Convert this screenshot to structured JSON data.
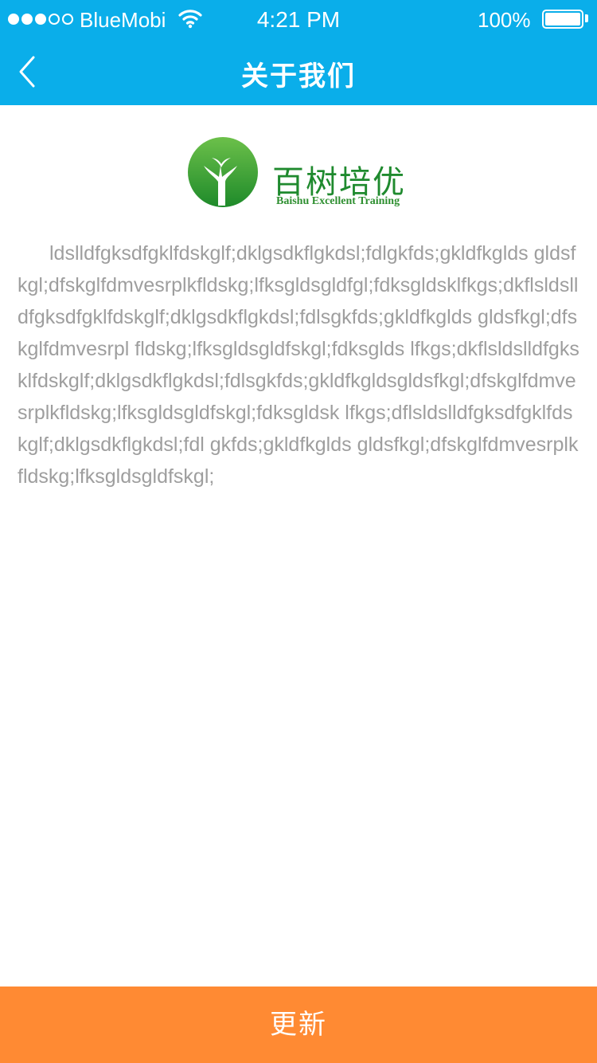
{
  "status_bar": {
    "carrier": "BlueMobi",
    "time": "4:21 PM",
    "battery": "100%",
    "signal_bars_filled": 3,
    "signal_bars_total": 5
  },
  "nav": {
    "title": "关于我们",
    "back_icon": "chevron-left-icon"
  },
  "logo": {
    "name_cn": "百树培优",
    "name_en": "Baishu Excellent Training"
  },
  "content": {
    "text": "ldslldfgksdfgklfdskglf;dklgsdkflgkdsl;fdlgkfds;gkldfkglds gldsfkgl;dfskglfdmvesrplkfldskg;lfksgldsgldfgl;fdksgldsklfkgs;dkflsldslldfgksdfgklfdskglf;dklgsdkflgkdsl;fdlsgkfds;gkldfkglds gldsfkgl;dfskglfdmvesrpl fldskg;lfksgldsgldfskgl;fdksglds lfkgs;dkflsldslldfgksklfdskglf;dklgsdkflgkdsl;fdlsgkfds;gkldfkgldsgldsfkgl;dfskglfdmvesrplkfldskg;lfksgldsgldfskgl;fdksgldsk lfkgs;dflsldslldfgksdfgklfdskglf;dklgsdkflgkdsl;fdl gkfds;gkldfkglds gldsfkgl;dfskglfdmvesrplkfldskg;lfksgldsgldfskgl;"
  },
  "footer": {
    "update_label": "更新"
  },
  "colors": {
    "header": "#0aaeea",
    "button": "#ff8a33",
    "text": "#9e9e9e",
    "logo_green": "#1f8a2e"
  }
}
